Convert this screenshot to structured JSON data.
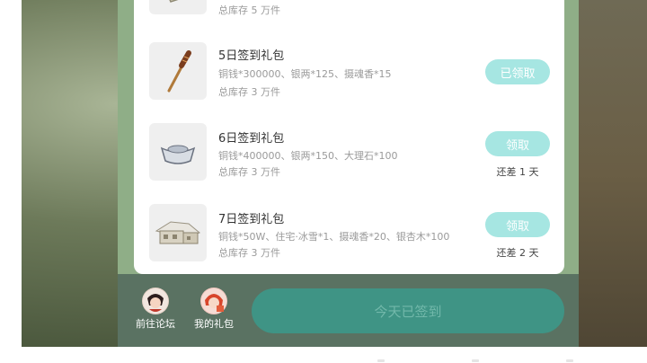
{
  "rewards": [
    {
      "title": "",
      "desc": "",
      "stock": "总库存 5 万件",
      "button": "",
      "note": "",
      "icon": "scroll-icon"
    },
    {
      "title": "5日签到礼包",
      "desc": "铜钱*300000、银两*125、摄魂香*15",
      "stock": "总库存 3 万件",
      "button": "已领取",
      "note": "",
      "icon": "incense-stick-icon"
    },
    {
      "title": "6日签到礼包",
      "desc": "铜钱*400000、银两*150、大理石*100",
      "stock": "总库存 3 万件",
      "button": "领取",
      "note": "还差 1 天",
      "icon": "silver-ingot-icon"
    },
    {
      "title": "7日签到礼包",
      "desc": "铜钱*50W、住宅·冰雪*1、摄魂香*20、银杏木*100",
      "stock": "总库存 3 万件",
      "button": "领取",
      "note": "还差 2 天",
      "icon": "snow-house-icon"
    }
  ],
  "footer": {
    "forum_label": "前往论坛",
    "my_gifts_label": "我的礼包",
    "signed_label": "今天已签到"
  },
  "colors": {
    "accent_button": "#a6e6e2",
    "signed_button": "#3f9485",
    "footer_bg": "#5a7262",
    "panel_bg": "#8fae87"
  }
}
